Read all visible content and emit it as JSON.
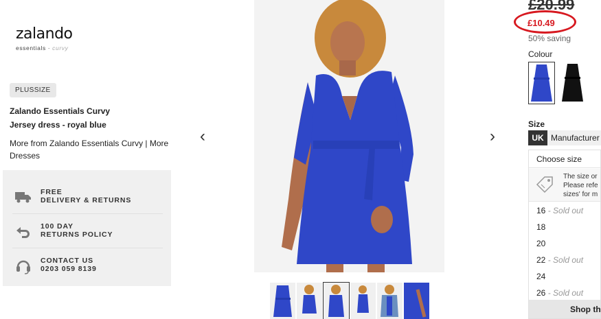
{
  "brand": {
    "name": "zalando",
    "sub_main": "essentials · ",
    "sub_accent": "curvy"
  },
  "product": {
    "tag": "PLUSSIZE",
    "title_line1": "Zalando Essentials Curvy",
    "title_line2": "Jersey dress - royal blue",
    "link_brand": "More from Zalando Essentials Curvy",
    "link_sep": " | ",
    "link_more": "More",
    "link_category": "Dresses"
  },
  "services": [
    {
      "icon": "truck-icon",
      "line1": "FREE",
      "line2": "DELIVERY & RETURNS"
    },
    {
      "icon": "return-arrow-icon",
      "line1": "100 DAY",
      "line2": "RETURNS POLICY"
    },
    {
      "icon": "headset-icon",
      "line1": "CONTACT US",
      "line2": "0203 059 8139"
    }
  ],
  "gallery": {
    "prev": "‹",
    "next": "›",
    "product_color": "#2f47c8",
    "thumb_count": 6,
    "active_thumb": 3
  },
  "pricing": {
    "old_price": "£20.99",
    "new_price": "£10.49",
    "saving": "50% saving",
    "highlight_color": "#d71920"
  },
  "colour": {
    "label": "Colour",
    "swatches": [
      {
        "name": "royal blue",
        "color": "#2f47c8",
        "selected": true
      },
      {
        "name": "black",
        "color": "#111111",
        "selected": false
      }
    ]
  },
  "size": {
    "label": "Size",
    "tab_uk": "UK",
    "tab_manufacturer": "Manufacturer",
    "choose": "Choose size",
    "info_line1": "The size or",
    "info_line2": "Please refe",
    "info_line3": "sizes' for m",
    "options": [
      {
        "size": "16",
        "status": "- Sold out"
      },
      {
        "size": "18",
        "status": ""
      },
      {
        "size": "20",
        "status": ""
      },
      {
        "size": "22",
        "status": "- Sold out"
      },
      {
        "size": "24",
        "status": ""
      },
      {
        "size": "26",
        "status": "- Sold out"
      }
    ],
    "shop_button": "Shop the"
  }
}
